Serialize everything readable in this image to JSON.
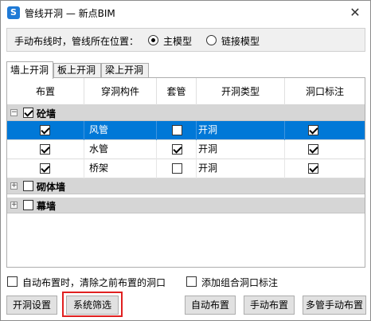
{
  "window": {
    "title": "管线开洞 — 新点BIM",
    "app_icon_letter": "S",
    "close_glyph": "✕"
  },
  "mode": {
    "label": "手动布线时，管线所在位置：",
    "options": [
      {
        "label": "主模型",
        "checked": true
      },
      {
        "label": "链接模型",
        "checked": false
      }
    ]
  },
  "tabs": [
    {
      "label": "墙上开洞",
      "active": true
    },
    {
      "label": "板上开洞",
      "active": false
    },
    {
      "label": "梁上开洞",
      "active": false
    }
  ],
  "grid": {
    "columns": [
      "布置",
      "穿洞构件",
      "套管",
      "开洞类型",
      "洞口标注"
    ],
    "groups": [
      {
        "name": "砼墙",
        "checked": true,
        "expanded": true,
        "expander_glyph": "−",
        "rows": [
          {
            "member": "风管",
            "place": true,
            "sleeve": false,
            "type": "开洞",
            "mark": true,
            "selected": true
          },
          {
            "member": "水管",
            "place": true,
            "sleeve": true,
            "type": "开洞",
            "mark": true,
            "selected": false
          },
          {
            "member": "桥架",
            "place": true,
            "sleeve": false,
            "type": "开洞",
            "mark": true,
            "selected": false
          }
        ]
      },
      {
        "name": "砌体墙",
        "checked": false,
        "expanded": false,
        "expander_glyph": "+",
        "rows": []
      },
      {
        "name": "幕墙",
        "checked": false,
        "expanded": false,
        "expander_glyph": "+",
        "rows": []
      }
    ]
  },
  "options": {
    "clear_previous": {
      "label": "自动布置时，清除之前布置的洞口",
      "checked": false
    },
    "combined_mark": {
      "label": "添加组合洞口标注",
      "checked": false
    }
  },
  "buttons": {
    "hole_settings": "开洞设置",
    "system_filter": "系统筛选",
    "auto_place": "自动布置",
    "manual_place": "手动布置",
    "multi_manual": "多管手动布置"
  },
  "colors": {
    "selection": "#0078d7",
    "group_row": "#d6d6d6",
    "highlight": "#e02020"
  }
}
